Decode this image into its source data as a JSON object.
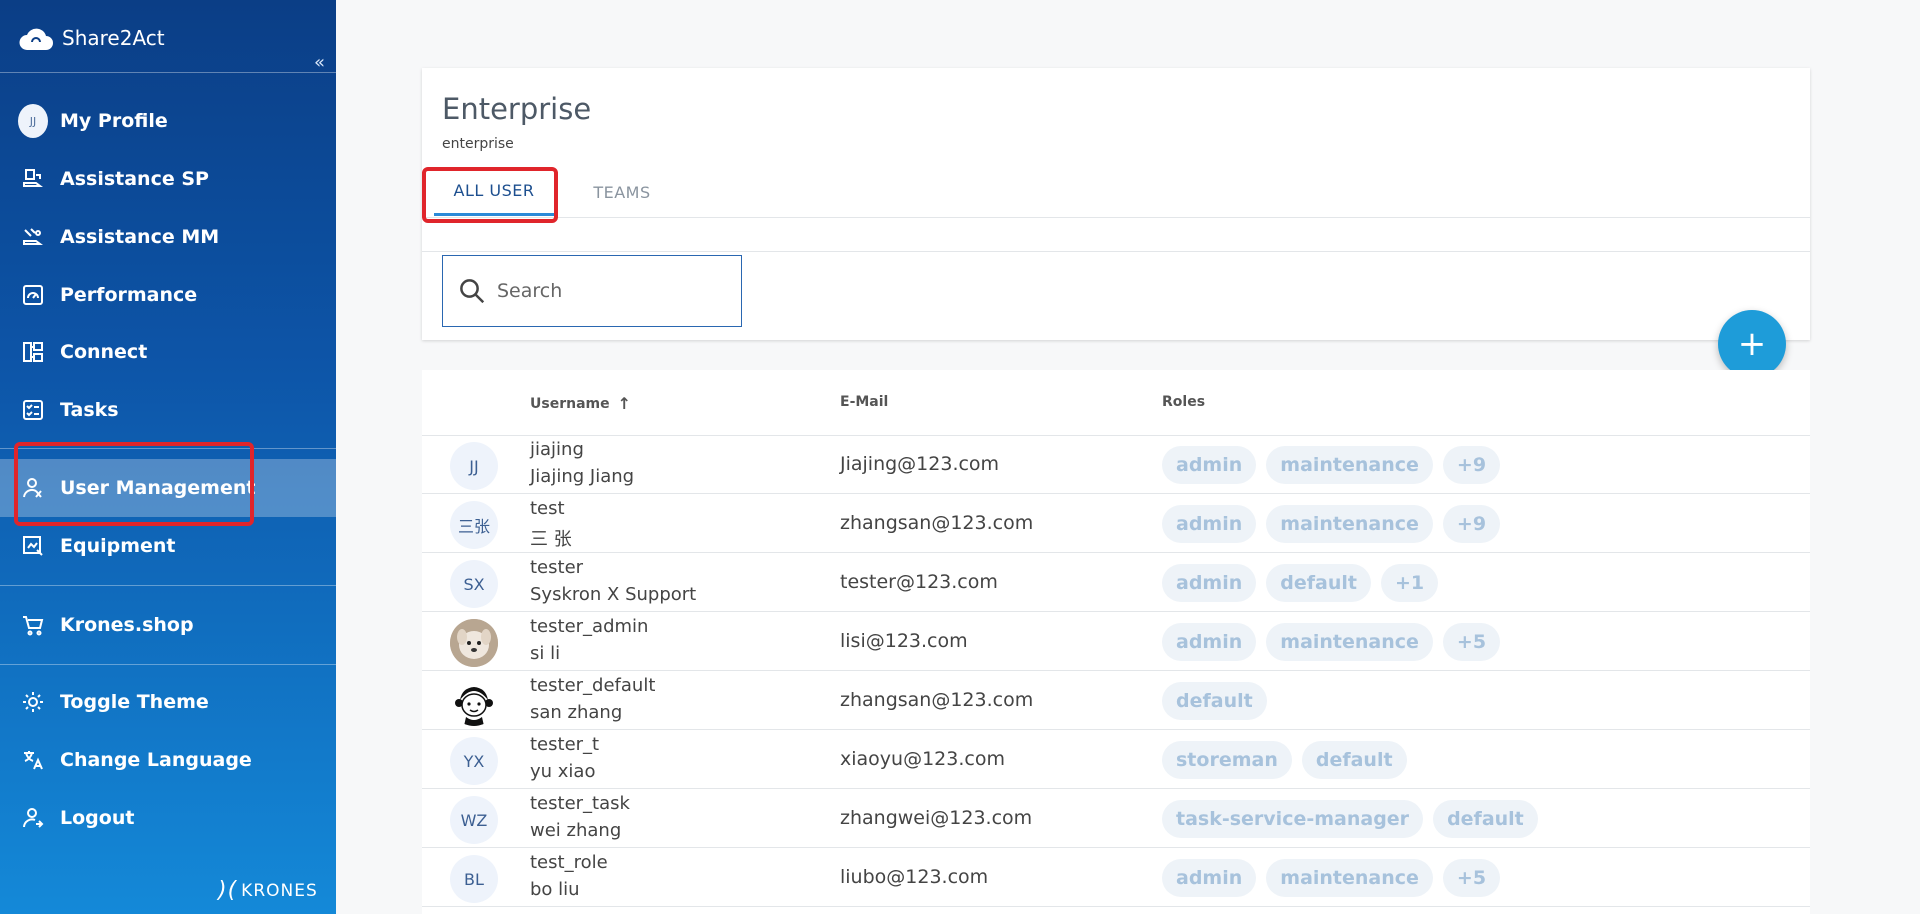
{
  "app": {
    "name": "Share2Act",
    "collapse_glyph": "«",
    "footer_brand": "KRONES"
  },
  "sidebar": {
    "profile": {
      "initials": "JJ",
      "label": "My Profile"
    },
    "items": [
      {
        "label": "Assistance SP",
        "icon": "assistance-sp-icon"
      },
      {
        "label": "Assistance MM",
        "icon": "assistance-mm-icon"
      },
      {
        "label": "Performance",
        "icon": "performance-icon"
      },
      {
        "label": "Connect",
        "icon": "connect-icon"
      },
      {
        "label": "Tasks",
        "icon": "tasks-icon"
      },
      {
        "label": "User Management",
        "icon": "user-management-icon",
        "active": true
      },
      {
        "label": "Equipment",
        "icon": "equipment-icon"
      },
      {
        "label": "Krones.shop",
        "icon": "cart-icon"
      },
      {
        "label": "Toggle Theme",
        "icon": "theme-icon"
      },
      {
        "label": "Change Language",
        "icon": "language-icon"
      },
      {
        "label": "Logout",
        "icon": "logout-icon"
      }
    ]
  },
  "page": {
    "title": "Enterprise",
    "subtitle": "enterprise",
    "tabs": [
      {
        "label": "ALL USER",
        "active": true
      },
      {
        "label": "TEAMS"
      }
    ],
    "search": {
      "placeholder": "Search",
      "value": ""
    },
    "fab_glyph": "+"
  },
  "table": {
    "headers": {
      "username": "Username",
      "email": "E-Mail",
      "roles": "Roles",
      "sort_glyph": "↑"
    },
    "rows": [
      {
        "avatar": "JJ",
        "avatar_type": "initials",
        "username": "jiajing",
        "fullname": "Jiajing Jiang",
        "email": "Jiajing@123.com",
        "roles": [
          "admin",
          "maintenance",
          "+9"
        ]
      },
      {
        "avatar": "三张",
        "avatar_type": "initials",
        "username": "test",
        "fullname": "三 张",
        "email": "zhangsan@123.com",
        "roles": [
          "admin",
          "maintenance",
          "+9"
        ]
      },
      {
        "avatar": "SX",
        "avatar_type": "initials",
        "username": "tester",
        "fullname": "Syskron X Support",
        "email": "tester@123.com",
        "roles": [
          "admin",
          "default",
          "+1"
        ]
      },
      {
        "avatar": "",
        "avatar_type": "photo-dog",
        "username": "tester_admin",
        "fullname": "si li",
        "email": "lisi@123.com",
        "roles": [
          "admin",
          "maintenance",
          "+5"
        ]
      },
      {
        "avatar": "",
        "avatar_type": "photo-cartoon",
        "username": "tester_default",
        "fullname": "san zhang",
        "email": "zhangsan@123.com",
        "roles": [
          "default"
        ]
      },
      {
        "avatar": "YX",
        "avatar_type": "initials",
        "username": "tester_t",
        "fullname": "yu xiao",
        "email": "xiaoyu@123.com",
        "roles": [
          "storeman",
          "default"
        ]
      },
      {
        "avatar": "WZ",
        "avatar_type": "initials",
        "username": "tester_task",
        "fullname": "wei zhang",
        "email": "zhangwei@123.com",
        "roles": [
          "task-service-manager",
          "default"
        ]
      },
      {
        "avatar": "BL",
        "avatar_type": "initials",
        "username": "test_role",
        "fullname": "bo liu",
        "email": "liubo@123.com",
        "roles": [
          "admin",
          "maintenance",
          "+5"
        ]
      }
    ]
  },
  "colors": {
    "sidebar_top": "#0b3e86",
    "sidebar_bottom": "#1489d8",
    "accent": "#1e9cd9",
    "highlight": "#e0252b",
    "chip_bg": "#eef3f8",
    "chip_text": "#a7c2dc"
  }
}
